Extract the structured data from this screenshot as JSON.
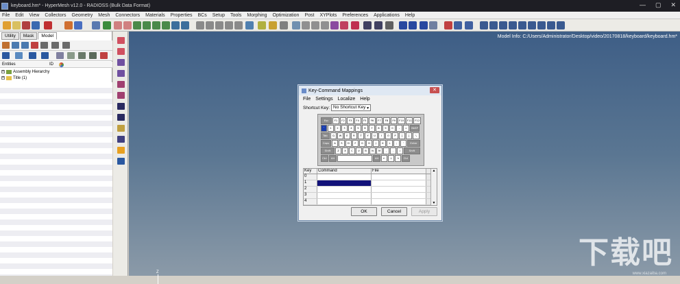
{
  "window": {
    "title": "keyboard.hm* - HyperMesh v12.0 - RADIOSS (Bulk Data Format)",
    "minimize": "—",
    "maximize": "▢",
    "close": "✕"
  },
  "menubar": [
    "File",
    "Edit",
    "View",
    "Collectors",
    "Geometry",
    "Mesh",
    "Connectors",
    "Materials",
    "Properties",
    "BCs",
    "Setup",
    "Tools",
    "Morphing",
    "Optimization",
    "Post",
    "XYPlots",
    "Preferences",
    "Applications",
    "Help"
  ],
  "left_panel": {
    "tabs": [
      "Utility",
      "Mask",
      "Model"
    ],
    "active_tab": "Model",
    "columns": {
      "entities": "Entities",
      "id": "ID"
    },
    "tree": [
      {
        "label": "Assembly Hierarchy"
      },
      {
        "label": "Title (1)"
      }
    ]
  },
  "viewport": {
    "model_info": "Model Info: C:/Users/Administrator/Desktop/video/20170818/keyboard/keyboard.hm*",
    "axis_label": "Z",
    "watermark": "下载吧",
    "watermark_small": "www.xiazaiba.com"
  },
  "dialog": {
    "title": "Key-Command Mappings",
    "menu": [
      "File",
      "Settings",
      "Localize",
      "Help"
    ],
    "shortcut_label": "Shortcut Key:",
    "shortcut_value": "No Shortcut Key",
    "keyboard": {
      "row0": [
        "Esc",
        "F1",
        "F2",
        "F3",
        "F4",
        "F5",
        "F6",
        "F7",
        "F8",
        "F9",
        "F10",
        "F11",
        "F12"
      ],
      "row1": [
        "`",
        "1",
        "2",
        "3",
        "4",
        "5",
        "6",
        "7",
        "8",
        "9",
        "0",
        "-",
        "=",
        "BkSP"
      ],
      "row2": [
        "Tab",
        "Q",
        "W",
        "E",
        "R",
        "T",
        "Y",
        "U",
        "I",
        "O",
        "P",
        "[",
        "]",
        "\\"
      ],
      "row3": [
        "Caps",
        "A",
        "S",
        "D",
        "F",
        "G",
        "H",
        "J",
        "K",
        "L",
        ";",
        "'",
        "Enter"
      ],
      "row4": [
        "Shift",
        "Z",
        "X",
        "C",
        "V",
        "B",
        "N",
        "M",
        ",",
        ".",
        "/",
        "Shift"
      ],
      "row5": [
        "Ctrl",
        "Alt",
        "",
        "Alt",
        "←",
        "↓",
        "→",
        "Ctrl"
      ]
    },
    "table": {
      "headers": [
        "Key",
        "Command",
        "File"
      ],
      "rows": [
        {
          "key": "0",
          "command": "",
          "file": ""
        },
        {
          "key": "1",
          "command": "",
          "file": ""
        },
        {
          "key": "2",
          "command": "",
          "file": ""
        },
        {
          "key": "3",
          "command": "",
          "file": ""
        },
        {
          "key": "4",
          "command": "",
          "file": ""
        }
      ],
      "selected_row": 1
    },
    "buttons": {
      "ok": "OK",
      "cancel": "Cancel",
      "apply": "Apply"
    }
  }
}
